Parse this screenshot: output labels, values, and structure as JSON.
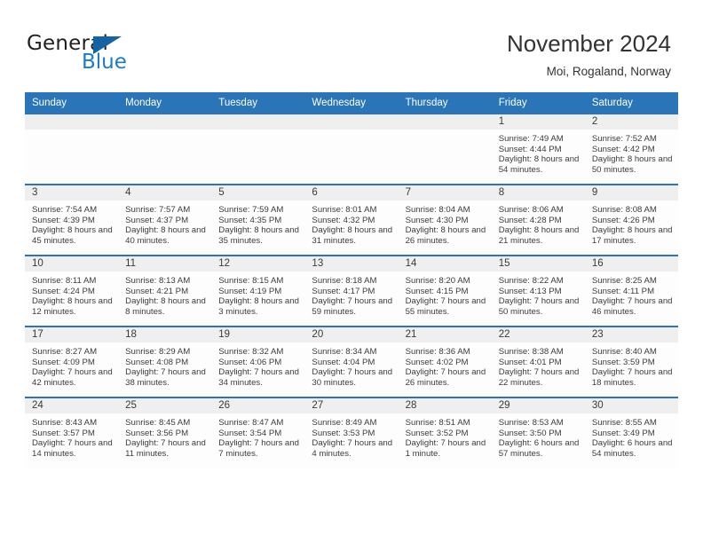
{
  "brand": {
    "name_top": "General",
    "name_bottom": "Blue",
    "accent_color": "#1a7cc6",
    "triangle_color": "#1464a5"
  },
  "header": {
    "title": "November 2024",
    "subtitle": "Moi, Rogaland, Norway",
    "header_bg": "#2a74b8",
    "day_band_bg": "#efefef"
  },
  "weekday_headers": [
    "Sunday",
    "Monday",
    "Tuesday",
    "Wednesday",
    "Thursday",
    "Friday",
    "Saturday"
  ],
  "labels": {
    "sunrise_prefix": "Sunrise:",
    "sunset_prefix": "Sunset:",
    "daylight_prefix": "Daylight:"
  },
  "weeks": [
    [
      {
        "day": "",
        "empty": true
      },
      {
        "day": "",
        "empty": true
      },
      {
        "day": "",
        "empty": true
      },
      {
        "day": "",
        "empty": true
      },
      {
        "day": "",
        "empty": true
      },
      {
        "day": "1",
        "sunrise": "Sunrise: 7:49 AM",
        "sunset": "Sunset: 4:44 PM",
        "daylight": "Daylight: 8 hours and 54 minutes."
      },
      {
        "day": "2",
        "sunrise": "Sunrise: 7:52 AM",
        "sunset": "Sunset: 4:42 PM",
        "daylight": "Daylight: 8 hours and 50 minutes."
      }
    ],
    [
      {
        "day": "3",
        "sunrise": "Sunrise: 7:54 AM",
        "sunset": "Sunset: 4:39 PM",
        "daylight": "Daylight: 8 hours and 45 minutes."
      },
      {
        "day": "4",
        "sunrise": "Sunrise: 7:57 AM",
        "sunset": "Sunset: 4:37 PM",
        "daylight": "Daylight: 8 hours and 40 minutes."
      },
      {
        "day": "5",
        "sunrise": "Sunrise: 7:59 AM",
        "sunset": "Sunset: 4:35 PM",
        "daylight": "Daylight: 8 hours and 35 minutes."
      },
      {
        "day": "6",
        "sunrise": "Sunrise: 8:01 AM",
        "sunset": "Sunset: 4:32 PM",
        "daylight": "Daylight: 8 hours and 31 minutes."
      },
      {
        "day": "7",
        "sunrise": "Sunrise: 8:04 AM",
        "sunset": "Sunset: 4:30 PM",
        "daylight": "Daylight: 8 hours and 26 minutes."
      },
      {
        "day": "8",
        "sunrise": "Sunrise: 8:06 AM",
        "sunset": "Sunset: 4:28 PM",
        "daylight": "Daylight: 8 hours and 21 minutes."
      },
      {
        "day": "9",
        "sunrise": "Sunrise: 8:08 AM",
        "sunset": "Sunset: 4:26 PM",
        "daylight": "Daylight: 8 hours and 17 minutes."
      }
    ],
    [
      {
        "day": "10",
        "sunrise": "Sunrise: 8:11 AM",
        "sunset": "Sunset: 4:24 PM",
        "daylight": "Daylight: 8 hours and 12 minutes."
      },
      {
        "day": "11",
        "sunrise": "Sunrise: 8:13 AM",
        "sunset": "Sunset: 4:21 PM",
        "daylight": "Daylight: 8 hours and 8 minutes."
      },
      {
        "day": "12",
        "sunrise": "Sunrise: 8:15 AM",
        "sunset": "Sunset: 4:19 PM",
        "daylight": "Daylight: 8 hours and 3 minutes."
      },
      {
        "day": "13",
        "sunrise": "Sunrise: 8:18 AM",
        "sunset": "Sunset: 4:17 PM",
        "daylight": "Daylight: 7 hours and 59 minutes."
      },
      {
        "day": "14",
        "sunrise": "Sunrise: 8:20 AM",
        "sunset": "Sunset: 4:15 PM",
        "daylight": "Daylight: 7 hours and 55 minutes."
      },
      {
        "day": "15",
        "sunrise": "Sunrise: 8:22 AM",
        "sunset": "Sunset: 4:13 PM",
        "daylight": "Daylight: 7 hours and 50 minutes."
      },
      {
        "day": "16",
        "sunrise": "Sunrise: 8:25 AM",
        "sunset": "Sunset: 4:11 PM",
        "daylight": "Daylight: 7 hours and 46 minutes."
      }
    ],
    [
      {
        "day": "17",
        "sunrise": "Sunrise: 8:27 AM",
        "sunset": "Sunset: 4:09 PM",
        "daylight": "Daylight: 7 hours and 42 minutes."
      },
      {
        "day": "18",
        "sunrise": "Sunrise: 8:29 AM",
        "sunset": "Sunset: 4:08 PM",
        "daylight": "Daylight: 7 hours and 38 minutes."
      },
      {
        "day": "19",
        "sunrise": "Sunrise: 8:32 AM",
        "sunset": "Sunset: 4:06 PM",
        "daylight": "Daylight: 7 hours and 34 minutes."
      },
      {
        "day": "20",
        "sunrise": "Sunrise: 8:34 AM",
        "sunset": "Sunset: 4:04 PM",
        "daylight": "Daylight: 7 hours and 30 minutes."
      },
      {
        "day": "21",
        "sunrise": "Sunrise: 8:36 AM",
        "sunset": "Sunset: 4:02 PM",
        "daylight": "Daylight: 7 hours and 26 minutes."
      },
      {
        "day": "22",
        "sunrise": "Sunrise: 8:38 AM",
        "sunset": "Sunset: 4:01 PM",
        "daylight": "Daylight: 7 hours and 22 minutes."
      },
      {
        "day": "23",
        "sunrise": "Sunrise: 8:40 AM",
        "sunset": "Sunset: 3:59 PM",
        "daylight": "Daylight: 7 hours and 18 minutes."
      }
    ],
    [
      {
        "day": "24",
        "sunrise": "Sunrise: 8:43 AM",
        "sunset": "Sunset: 3:57 PM",
        "daylight": "Daylight: 7 hours and 14 minutes."
      },
      {
        "day": "25",
        "sunrise": "Sunrise: 8:45 AM",
        "sunset": "Sunset: 3:56 PM",
        "daylight": "Daylight: 7 hours and 11 minutes."
      },
      {
        "day": "26",
        "sunrise": "Sunrise: 8:47 AM",
        "sunset": "Sunset: 3:54 PM",
        "daylight": "Daylight: 7 hours and 7 minutes."
      },
      {
        "day": "27",
        "sunrise": "Sunrise: 8:49 AM",
        "sunset": "Sunset: 3:53 PM",
        "daylight": "Daylight: 7 hours and 4 minutes."
      },
      {
        "day": "28",
        "sunrise": "Sunrise: 8:51 AM",
        "sunset": "Sunset: 3:52 PM",
        "daylight": "Daylight: 7 hours and 1 minute."
      },
      {
        "day": "29",
        "sunrise": "Sunrise: 8:53 AM",
        "sunset": "Sunset: 3:50 PM",
        "daylight": "Daylight: 6 hours and 57 minutes."
      },
      {
        "day": "30",
        "sunrise": "Sunrise: 8:55 AM",
        "sunset": "Sunset: 3:49 PM",
        "daylight": "Daylight: 6 hours and 54 minutes."
      }
    ]
  ]
}
